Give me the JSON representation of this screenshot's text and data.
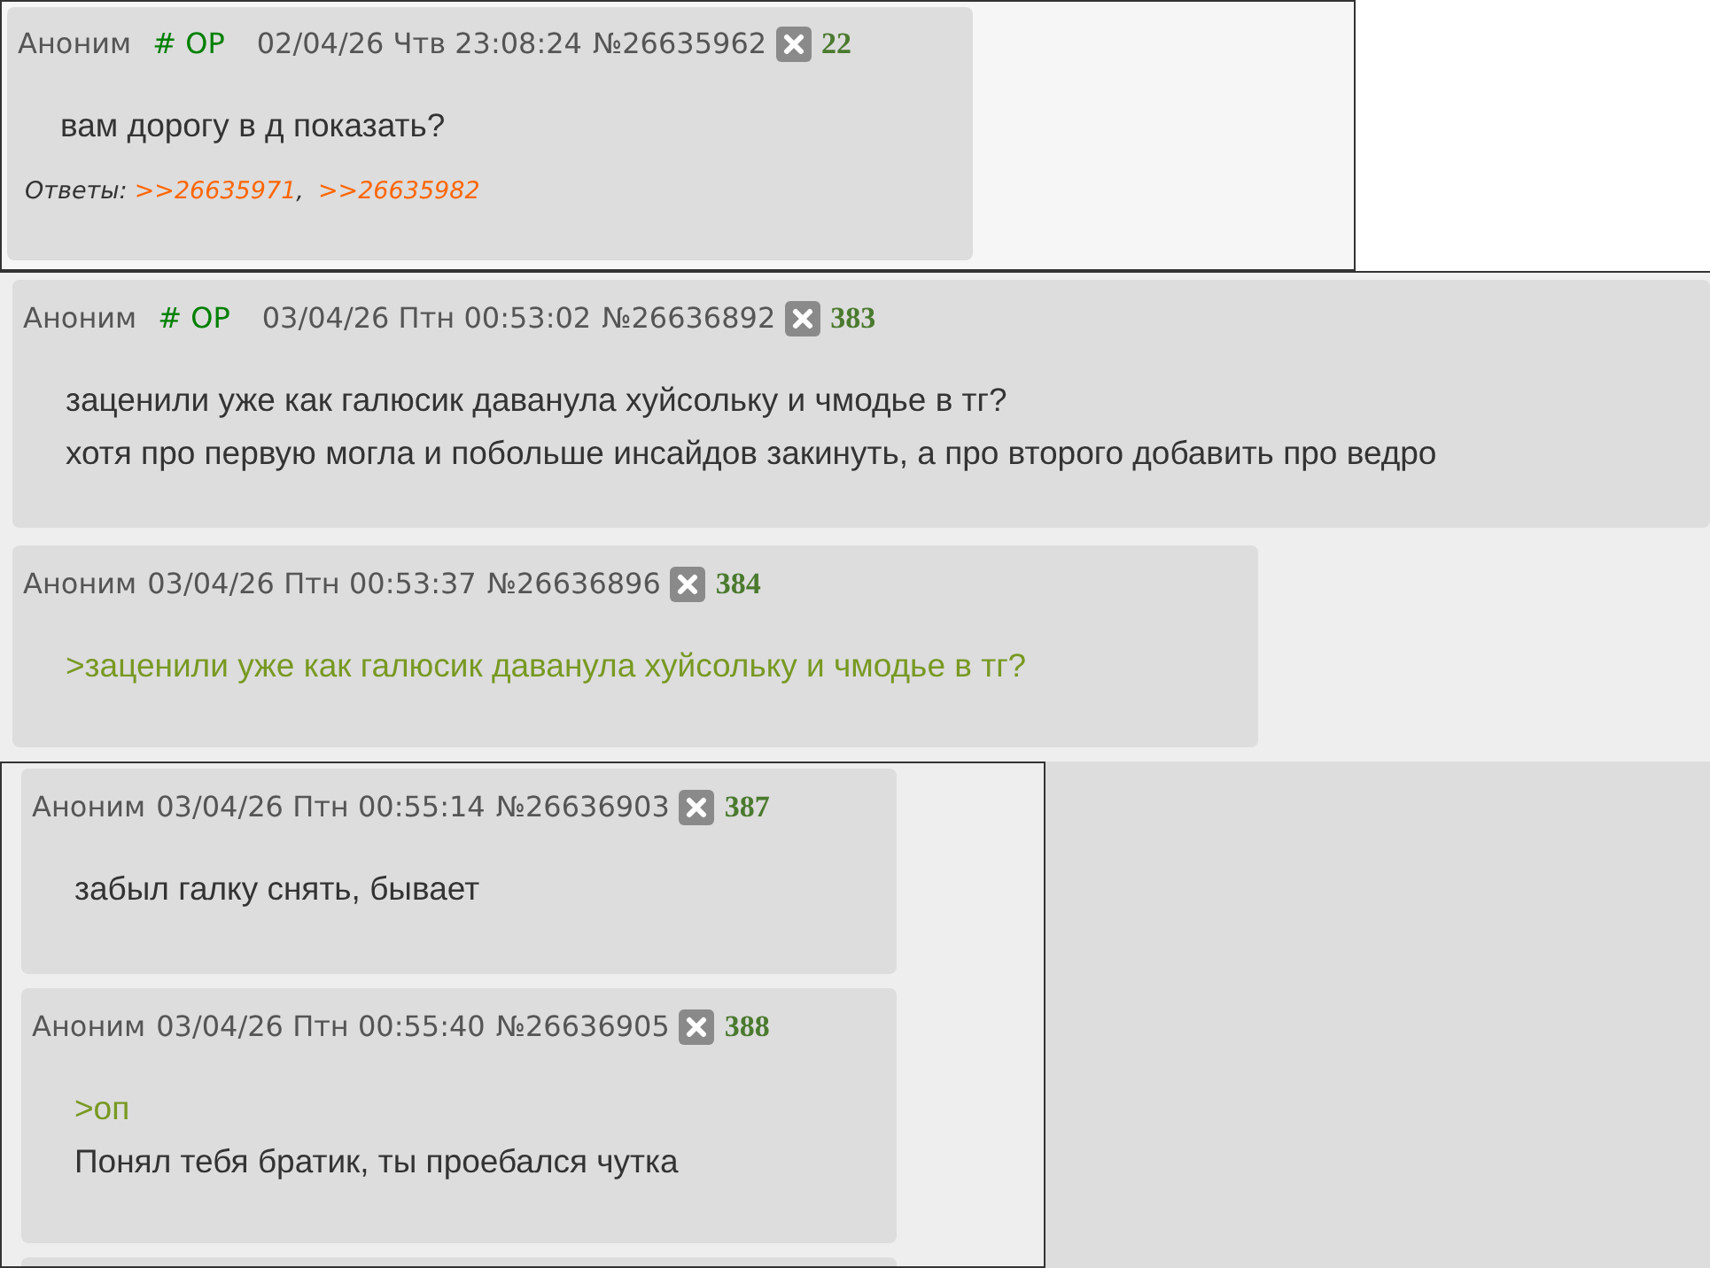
{
  "frames": [
    {
      "posts": [
        {
          "name": "Аноним",
          "trip": "# OP",
          "date": "02/04/26 Чтв 23:08:24",
          "number": "№26635962",
          "count": "22",
          "lines": [
            {
              "kind": "text",
              "text": "вам дорогу в д показать?"
            }
          ],
          "replies": {
            "label": "Ответы:",
            "links": [
              ">>26635971",
              ">>26635982"
            ],
            "separator": ","
          }
        }
      ]
    },
    {
      "posts": [
        {
          "name": "Аноним",
          "trip": "# OP",
          "date": "03/04/26 Птн 00:53:02",
          "number": "№26636892",
          "count": "383",
          "lines": [
            {
              "kind": "text",
              "text": "заценили уже как галюсик даванула хуйсольку и чмодье в тг?"
            },
            {
              "kind": "text",
              "text": "хотя про первую могла и побольше инсайдов закинуть, а про второго добавить про ведро"
            }
          ]
        },
        {
          "name": "Аноним",
          "date": "03/04/26 Птн 00:53:37",
          "number": "№26636896",
          "count": "384",
          "lines": [
            {
              "kind": "quote",
              "text": ">заценили уже как галюсик даванула хуйсольку и чмодье в тг?"
            }
          ]
        }
      ]
    },
    {
      "posts": [
        {
          "name": "Аноним",
          "date": "03/04/26 Птн 00:55:14",
          "number": "№26636903",
          "count": "387",
          "lines": [
            {
              "kind": "text",
              "text": "забыл галку снять, бывает"
            }
          ]
        },
        {
          "name": "Аноним",
          "date": "03/04/26 Птн 00:55:40",
          "number": "№26636905",
          "count": "388",
          "lines": [
            {
              "kind": "quote",
              "text": ">оп"
            },
            {
              "kind": "text",
              "text": "Понял тебя братик, ты проебался чутка"
            }
          ]
        }
      ],
      "partial_post": true
    }
  ]
}
